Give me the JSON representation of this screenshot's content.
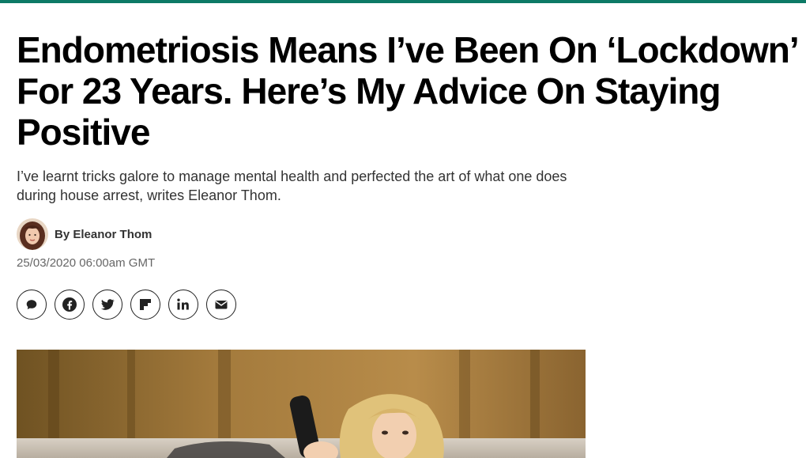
{
  "article": {
    "headline": "Endometriosis Means I’ve Been On ‘Lockdown’ For 23 Years. Here’s My Advice On Staying Positive",
    "dek": "I’ve learnt tricks galore to manage mental health and perfected the art of what one does during house arrest, writes Eleanor Thom.",
    "byline_prefix": "By",
    "author": "Eleanor Thom",
    "timestamp": "25/03/2020 06:00am GMT"
  },
  "share": [
    {
      "icon": "comment-icon"
    },
    {
      "icon": "facebook-icon"
    },
    {
      "icon": "twitter-icon"
    },
    {
      "icon": "flipboard-icon"
    },
    {
      "icon": "linkedin-icon"
    },
    {
      "icon": "email-icon"
    }
  ],
  "colors": {
    "accent_bar": "#0d7a66",
    "headline": "#000000",
    "text": "#333333",
    "timestamp": "#666666"
  }
}
